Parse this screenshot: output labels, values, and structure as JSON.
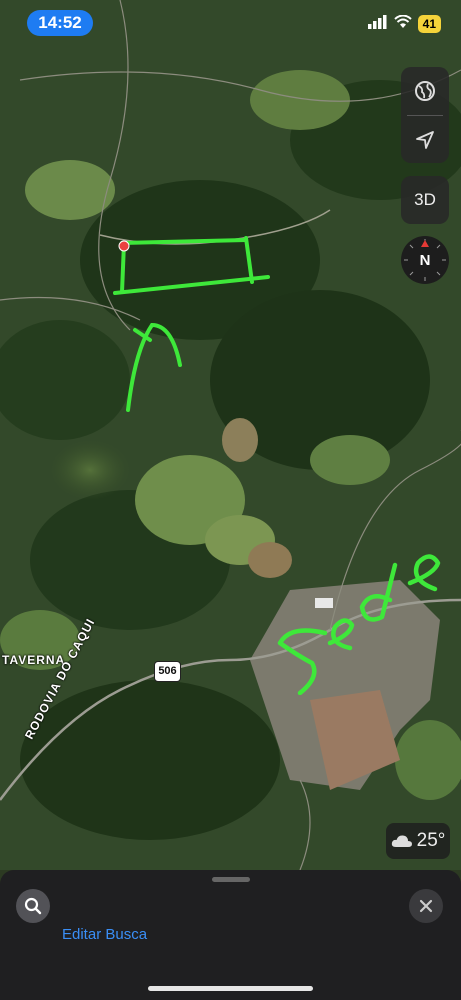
{
  "status_bar": {
    "time": "14:52",
    "battery": "41",
    "icons": [
      "signal-icon",
      "wifi-icon",
      "battery-icon"
    ]
  },
  "map": {
    "type": "satellite",
    "labels": {
      "road_name_1": "TAVERNA",
      "road_name_2": "RODOVIA DO CAQUI",
      "highway_shield": "506"
    },
    "annotation": {
      "handwritten_text": "Sede",
      "color": "#3ee83a"
    }
  },
  "controls": {
    "globe_icon": "globe-icon",
    "location_icon": "location-arrow-icon",
    "view_3d_label": "3D",
    "compass_label": "N"
  },
  "weather": {
    "icon": "cloud-icon",
    "temperature": "25°"
  },
  "bottom_sheet": {
    "edit_search_label": "Editar Busca",
    "search_icon": "search-icon",
    "close_icon": "close-icon"
  }
}
